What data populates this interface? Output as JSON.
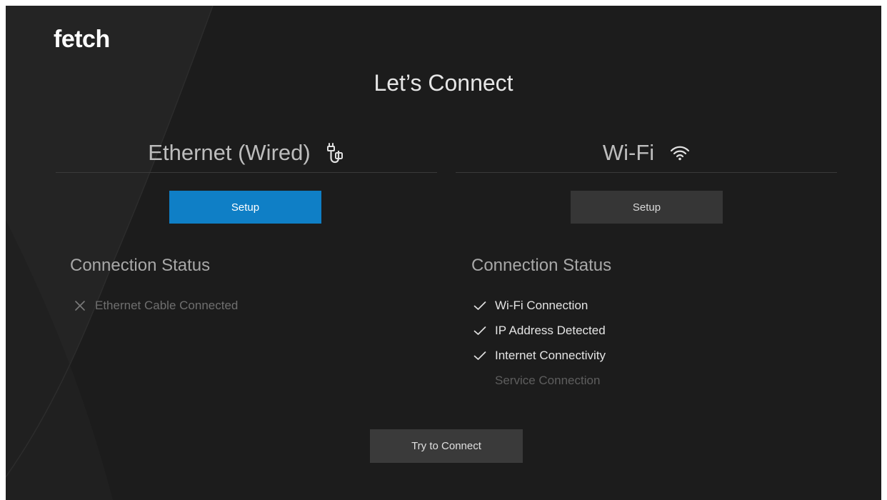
{
  "brand": {
    "logo_text": "fetch"
  },
  "page": {
    "title": "Let’s Connect"
  },
  "ethernet": {
    "heading": "Ethernet (Wired)",
    "icon": "ethernet-cable-icon",
    "setup_label": "Setup",
    "status_heading": "Connection Status",
    "status_items": [
      {
        "label": "Ethernet Cable Connected",
        "state": "fail",
        "icon": "x-icon"
      }
    ]
  },
  "wifi": {
    "heading": "Wi-Fi",
    "icon": "wifi-icon",
    "setup_label": "Setup",
    "status_heading": "Connection Status",
    "status_items": [
      {
        "label": "Wi-Fi Connection",
        "state": "ok",
        "icon": "check-icon"
      },
      {
        "label": "IP Address Detected",
        "state": "ok",
        "icon": "check-icon"
      },
      {
        "label": "Internet Connectivity",
        "state": "ok",
        "icon": "check-icon"
      },
      {
        "label": "Service Connection",
        "state": "pending",
        "icon": ""
      }
    ]
  },
  "actions": {
    "try_label": "Try to Connect"
  },
  "colors": {
    "background": "#1c1c1c",
    "accent": "#0f7fc6",
    "button_secondary": "#363636",
    "text_primary": "#e6e6e6",
    "text_muted": "#6f6f6f"
  }
}
